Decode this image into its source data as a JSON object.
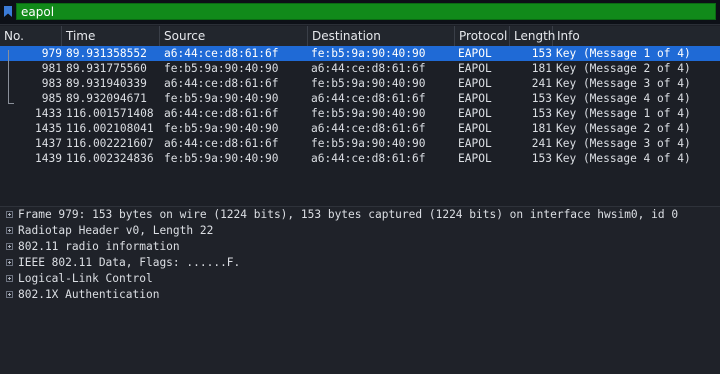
{
  "filter": {
    "value": "eapol"
  },
  "columns": [
    "No.",
    "Time",
    "Source",
    "Destination",
    "Protocol",
    "Length",
    "Info"
  ],
  "packets": [
    {
      "no": "979",
      "time": "89.931358552",
      "src": "a6:44:ce:d8:61:6f",
      "dst": "fe:b5:9a:90:40:90",
      "proto": "EAPOL",
      "len": "153",
      "info": "Key (Message 1 of 4)",
      "selected": true
    },
    {
      "no": "981",
      "time": "89.931775560",
      "src": "fe:b5:9a:90:40:90",
      "dst": "a6:44:ce:d8:61:6f",
      "proto": "EAPOL",
      "len": "181",
      "info": "Key (Message 2 of 4)"
    },
    {
      "no": "983",
      "time": "89.931940339",
      "src": "a6:44:ce:d8:61:6f",
      "dst": "fe:b5:9a:90:40:90",
      "proto": "EAPOL",
      "len": "241",
      "info": "Key (Message 3 of 4)"
    },
    {
      "no": "985",
      "time": "89.932094671",
      "src": "fe:b5:9a:90:40:90",
      "dst": "a6:44:ce:d8:61:6f",
      "proto": "EAPOL",
      "len": "153",
      "info": "Key (Message 4 of 4)"
    },
    {
      "no": "1433",
      "time": "116.001571408",
      "src": "a6:44:ce:d8:61:6f",
      "dst": "fe:b5:9a:90:40:90",
      "proto": "EAPOL",
      "len": "153",
      "info": "Key (Message 1 of 4)"
    },
    {
      "no": "1435",
      "time": "116.002108041",
      "src": "fe:b5:9a:90:40:90",
      "dst": "a6:44:ce:d8:61:6f",
      "proto": "EAPOL",
      "len": "181",
      "info": "Key (Message 2 of 4)"
    },
    {
      "no": "1437",
      "time": "116.002221607",
      "src": "a6:44:ce:d8:61:6f",
      "dst": "fe:b5:9a:90:40:90",
      "proto": "EAPOL",
      "len": "241",
      "info": "Key (Message 3 of 4)"
    },
    {
      "no": "1439",
      "time": "116.002324836",
      "src": "fe:b5:9a:90:40:90",
      "dst": "a6:44:ce:d8:61:6f",
      "proto": "EAPOL",
      "len": "153",
      "info": "Key (Message 4 of 4)"
    }
  ],
  "details": [
    "Frame 979: 153 bytes on wire (1224 bits), 153 bytes captured (1224 bits) on interface hwsim0, id 0",
    "Radiotap Header v0, Length 22",
    "802.11 radio information",
    "IEEE 802.11 Data, Flags: ......F.",
    "Logical-Link Control",
    "802.1X Authentication"
  ],
  "icons": {
    "bookmark": "bookmark-icon",
    "expander": "expand-plus-icon"
  },
  "colors": {
    "selected_row": "#1f6ad6",
    "filter_valid": "#118a1a",
    "background": "#1c1f26"
  }
}
